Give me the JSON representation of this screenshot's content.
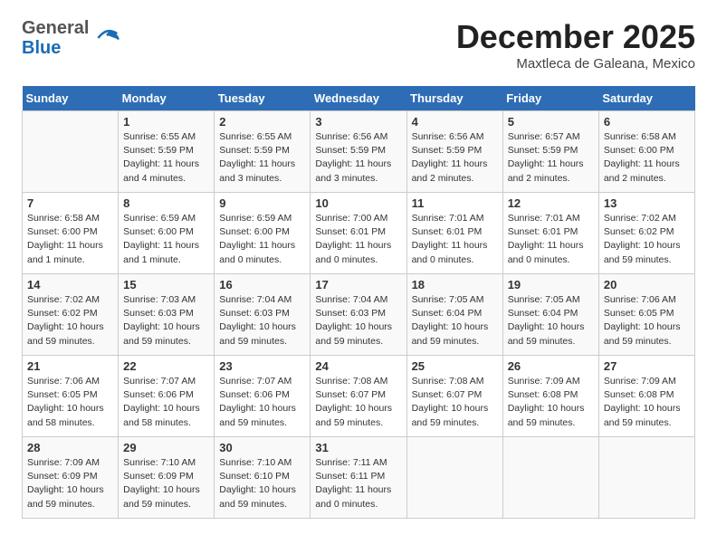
{
  "header": {
    "logo_general": "General",
    "logo_blue": "Blue",
    "month_title": "December 2025",
    "location": "Maxtleca de Galeana, Mexico"
  },
  "days_of_week": [
    "Sunday",
    "Monday",
    "Tuesday",
    "Wednesday",
    "Thursday",
    "Friday",
    "Saturday"
  ],
  "weeks": [
    [
      {
        "day": "",
        "info": ""
      },
      {
        "day": "1",
        "info": "Sunrise: 6:55 AM\nSunset: 5:59 PM\nDaylight: 11 hours\nand 4 minutes."
      },
      {
        "day": "2",
        "info": "Sunrise: 6:55 AM\nSunset: 5:59 PM\nDaylight: 11 hours\nand 3 minutes."
      },
      {
        "day": "3",
        "info": "Sunrise: 6:56 AM\nSunset: 5:59 PM\nDaylight: 11 hours\nand 3 minutes."
      },
      {
        "day": "4",
        "info": "Sunrise: 6:56 AM\nSunset: 5:59 PM\nDaylight: 11 hours\nand 2 minutes."
      },
      {
        "day": "5",
        "info": "Sunrise: 6:57 AM\nSunset: 5:59 PM\nDaylight: 11 hours\nand 2 minutes."
      },
      {
        "day": "6",
        "info": "Sunrise: 6:58 AM\nSunset: 6:00 PM\nDaylight: 11 hours\nand 2 minutes."
      }
    ],
    [
      {
        "day": "7",
        "info": "Sunrise: 6:58 AM\nSunset: 6:00 PM\nDaylight: 11 hours\nand 1 minute."
      },
      {
        "day": "8",
        "info": "Sunrise: 6:59 AM\nSunset: 6:00 PM\nDaylight: 11 hours\nand 1 minute."
      },
      {
        "day": "9",
        "info": "Sunrise: 6:59 AM\nSunset: 6:00 PM\nDaylight: 11 hours\nand 0 minutes."
      },
      {
        "day": "10",
        "info": "Sunrise: 7:00 AM\nSunset: 6:01 PM\nDaylight: 11 hours\nand 0 minutes."
      },
      {
        "day": "11",
        "info": "Sunrise: 7:01 AM\nSunset: 6:01 PM\nDaylight: 11 hours\nand 0 minutes."
      },
      {
        "day": "12",
        "info": "Sunrise: 7:01 AM\nSunset: 6:01 PM\nDaylight: 11 hours\nand 0 minutes."
      },
      {
        "day": "13",
        "info": "Sunrise: 7:02 AM\nSunset: 6:02 PM\nDaylight: 10 hours\nand 59 minutes."
      }
    ],
    [
      {
        "day": "14",
        "info": "Sunrise: 7:02 AM\nSunset: 6:02 PM\nDaylight: 10 hours\nand 59 minutes."
      },
      {
        "day": "15",
        "info": "Sunrise: 7:03 AM\nSunset: 6:03 PM\nDaylight: 10 hours\nand 59 minutes."
      },
      {
        "day": "16",
        "info": "Sunrise: 7:04 AM\nSunset: 6:03 PM\nDaylight: 10 hours\nand 59 minutes."
      },
      {
        "day": "17",
        "info": "Sunrise: 7:04 AM\nSunset: 6:03 PM\nDaylight: 10 hours\nand 59 minutes."
      },
      {
        "day": "18",
        "info": "Sunrise: 7:05 AM\nSunset: 6:04 PM\nDaylight: 10 hours\nand 59 minutes."
      },
      {
        "day": "19",
        "info": "Sunrise: 7:05 AM\nSunset: 6:04 PM\nDaylight: 10 hours\nand 59 minutes."
      },
      {
        "day": "20",
        "info": "Sunrise: 7:06 AM\nSunset: 6:05 PM\nDaylight: 10 hours\nand 59 minutes."
      }
    ],
    [
      {
        "day": "21",
        "info": "Sunrise: 7:06 AM\nSunset: 6:05 PM\nDaylight: 10 hours\nand 58 minutes."
      },
      {
        "day": "22",
        "info": "Sunrise: 7:07 AM\nSunset: 6:06 PM\nDaylight: 10 hours\nand 58 minutes."
      },
      {
        "day": "23",
        "info": "Sunrise: 7:07 AM\nSunset: 6:06 PM\nDaylight: 10 hours\nand 59 minutes."
      },
      {
        "day": "24",
        "info": "Sunrise: 7:08 AM\nSunset: 6:07 PM\nDaylight: 10 hours\nand 59 minutes."
      },
      {
        "day": "25",
        "info": "Sunrise: 7:08 AM\nSunset: 6:07 PM\nDaylight: 10 hours\nand 59 minutes."
      },
      {
        "day": "26",
        "info": "Sunrise: 7:09 AM\nSunset: 6:08 PM\nDaylight: 10 hours\nand 59 minutes."
      },
      {
        "day": "27",
        "info": "Sunrise: 7:09 AM\nSunset: 6:08 PM\nDaylight: 10 hours\nand 59 minutes."
      }
    ],
    [
      {
        "day": "28",
        "info": "Sunrise: 7:09 AM\nSunset: 6:09 PM\nDaylight: 10 hours\nand 59 minutes."
      },
      {
        "day": "29",
        "info": "Sunrise: 7:10 AM\nSunset: 6:09 PM\nDaylight: 10 hours\nand 59 minutes."
      },
      {
        "day": "30",
        "info": "Sunrise: 7:10 AM\nSunset: 6:10 PM\nDaylight: 10 hours\nand 59 minutes."
      },
      {
        "day": "31",
        "info": "Sunrise: 7:11 AM\nSunset: 6:11 PM\nDaylight: 11 hours\nand 0 minutes."
      },
      {
        "day": "",
        "info": ""
      },
      {
        "day": "",
        "info": ""
      },
      {
        "day": "",
        "info": ""
      }
    ]
  ]
}
